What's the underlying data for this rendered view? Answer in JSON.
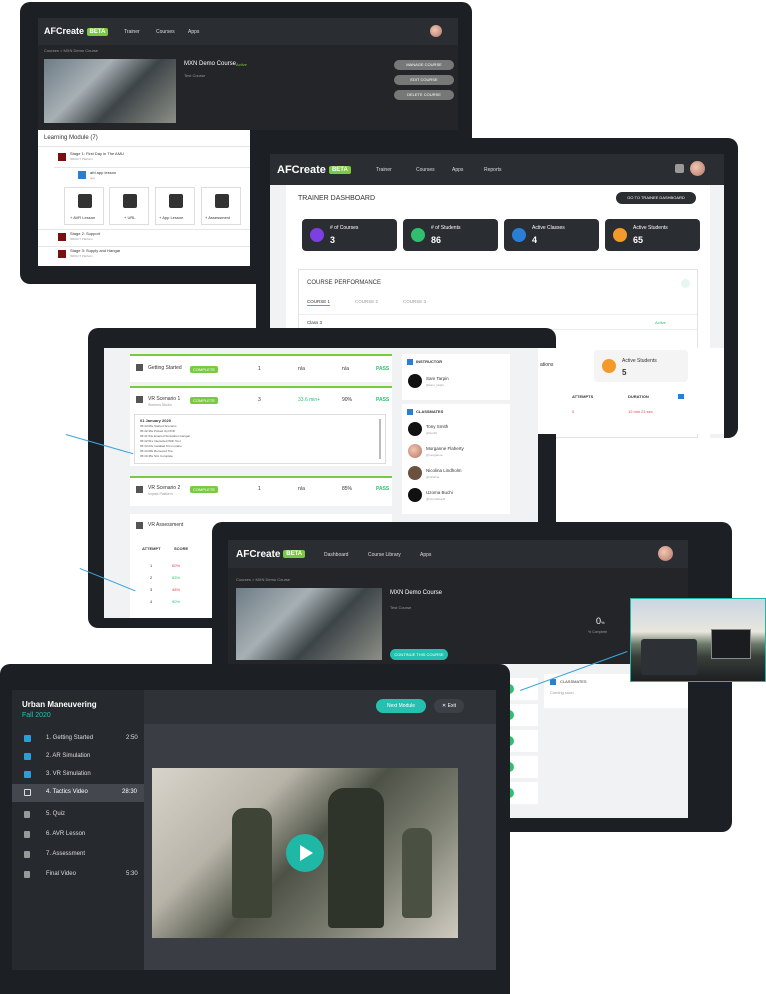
{
  "brand": {
    "name": "AFCreate",
    "badge": "BETA"
  },
  "screen1": {
    "nav": [
      "Trainer",
      "Courses",
      "Apps"
    ],
    "breadcrumb": "Courses > MXN Demo Course",
    "course_title": "MXN Demo Course",
    "status": "Active",
    "subtitle": "Test Course",
    "actions": [
      "MANAGE COURSE",
      "EDIT COURSE",
      "DELETE COURSE"
    ],
    "modules_heading": "Learning Module (7)",
    "stages": [
      {
        "title": "Stage 1: First Day in The AMU",
        "sub": "IMPACT Platform"
      },
      {
        "title": "Stage 2: Support",
        "sub": "IMPACT Platform"
      },
      {
        "title": "Stage 3: Supply and Hangar",
        "sub": "IMPACT Platform"
      }
    ],
    "lesson": {
      "title": "afd app lesson",
      "sub": "app"
    },
    "add_options": [
      "+ AVR Lesson",
      "+ URL",
      "+ App Lesson",
      "+ Assessment"
    ]
  },
  "screen2": {
    "nav": [
      "Trainer",
      "Courses",
      "Apps",
      "Reports"
    ],
    "heading": "TRAINER DASHBOARD",
    "go_button": "GO TO TRAINEE DASHBOARD",
    "stats": [
      {
        "label": "# of Courses",
        "value": "3",
        "color": "#7b3fe4"
      },
      {
        "label": "# of Students",
        "value": "86",
        "color": "#2fbf6f"
      },
      {
        "label": "Active Classes",
        "value": "4",
        "color": "#2a7fd4"
      },
      {
        "label": "Active Students",
        "value": "65",
        "color": "#f39a2b"
      }
    ],
    "performance_title": "COURSE PERFORMANCE",
    "tabs": [
      "COURSE 1",
      "COURSE 2",
      "COURSE 3"
    ],
    "class_label": "Class 3",
    "class_status": "Active"
  },
  "screen3": {
    "rows": [
      {
        "title": "Getting Started",
        "badge": "COMPLETE",
        "count": "1",
        "time": "n/a",
        "score": "n/a",
        "result": "PASS"
      },
      {
        "title": "VR Scenario 1",
        "sub": "Workers Studio",
        "badge": "COMPLETE",
        "count": "3",
        "time": "33.6 min+",
        "score": "90%",
        "result": "PASS"
      },
      {
        "title": "VR Scenario 2",
        "sub": "Impact Platform",
        "badge": "COMPLETE",
        "count": "1",
        "time": "n/a",
        "score": "85%",
        "result": "PASS"
      }
    ],
    "log_date": "01 January 2020",
    "log": [
      [
        "05:43:06s",
        "Started Scenario"
      ],
      [
        "05:42:36s",
        "Picked Up PDD"
      ],
      [
        "05:41:54s",
        "Entered Simulation Hangar"
      ],
      [
        "05:42:51s",
        "Interacted With Tool"
      ],
      [
        "05:43:23s",
        "Installed Kit on plane"
      ],
      [
        "05:44:08s",
        "Removed Tire"
      ],
      [
        "05:43:45s",
        "Sim Complete"
      ]
    ],
    "instructor_heading": "INSTRUCTOR",
    "instructor": {
      "name": "Sam Tarpin",
      "handle": "@sam_tarpin"
    },
    "classmates_heading": "CLASSMATES",
    "classmates": [
      {
        "name": "Tony Smith",
        "handle": "@tsmith"
      },
      {
        "name": "Morganne Flaherty",
        "handle": "@morganne"
      },
      {
        "name": "Nicolina Lindholm",
        "handle": "@nicolina"
      },
      {
        "name": "Uzoma Buchi",
        "handle": "@uzomabuchi"
      }
    ],
    "assessment_title": "VR Assessment",
    "assessment_headers": [
      "ATTEMPT",
      "SCORE"
    ],
    "attempts": [
      {
        "n": "1",
        "score": "60%",
        "color": "#e04646"
      },
      {
        "n": "2",
        "score": "83%",
        "color": "#2fbf6f"
      },
      {
        "n": "3",
        "score": "48%",
        "color": "#e04646"
      },
      {
        "n": "4",
        "score": "90%",
        "color": "#2fbf6f"
      }
    ],
    "right_active_label": "Active Students",
    "right_active_value": "5",
    "right_partial_label": "ations",
    "right_headers": [
      "ATTEMPTS",
      "DURATION"
    ],
    "right_row": {
      "attempts": "0",
      "duration": "12 min 21 sec"
    }
  },
  "screen4": {
    "nav": [
      "Dashboard",
      "Course Library",
      "Apps"
    ],
    "breadcrumb": "Courses > MXN Demo Course",
    "course_title": "MXN Demo Course",
    "subtitle": "Test Course",
    "progress_value": "0",
    "progress_unit": "%",
    "progress_label": "% Complete",
    "continue_button": "CONTINUE THIS COURSE",
    "classmates_heading": "CLASSMATES",
    "coming_soon": "Coming soon."
  },
  "screen5": {
    "course_title": "Urban Maneuvering",
    "term": "Fall 2020",
    "next_button": "Next Module",
    "exit_button": "Exit",
    "items": [
      {
        "label": "1. Getting Started",
        "time": "2:50",
        "state": "done"
      },
      {
        "label": "2. AR Simulation",
        "time": "",
        "state": "done"
      },
      {
        "label": "3. VR Simulation",
        "time": "",
        "state": "done"
      },
      {
        "label": "4. Tactics Video",
        "time": "28:30",
        "state": "current"
      },
      {
        "label": "5. Quiz",
        "time": "",
        "state": "locked"
      },
      {
        "label": "6. AVR Lesson",
        "time": "",
        "state": "locked"
      },
      {
        "label": "7. Assessment",
        "time": "",
        "state": "locked"
      },
      {
        "label": "Final Video",
        "time": "5:30",
        "state": "locked"
      }
    ]
  },
  "colors": {
    "accent": "#25c1b0",
    "green": "#2fbf6f",
    "red": "#e04646",
    "dark": "#2a2d31"
  }
}
